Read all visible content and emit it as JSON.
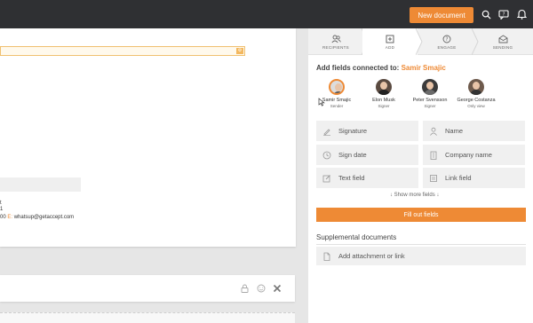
{
  "topbar": {
    "new_document_label": "New document"
  },
  "document": {
    "contact_line_1": "t",
    "contact_line_2": "1",
    "contact_prefix": "00",
    "contact_email_label": "E:",
    "contact_email": "whatsup@getaccept.com"
  },
  "steps": [
    {
      "label": "RECIPIENTS",
      "icon": "recipients-icon"
    },
    {
      "label": "ADD",
      "icon": "add-icon"
    },
    {
      "label": "ENGAGE",
      "icon": "engage-icon"
    },
    {
      "label": "SENDING",
      "icon": "sending-icon"
    }
  ],
  "panel": {
    "heading_prefix": "Add fields connected to:",
    "heading_name": "Samir Smajic",
    "recipients": [
      {
        "name": "Samir Smajic",
        "role": "Sender"
      },
      {
        "name": "Elon Musk",
        "role": "Signer"
      },
      {
        "name": "Peter Svensson",
        "role": "Signer"
      },
      {
        "name": "George Costanza",
        "role": "Only view"
      }
    ],
    "fields": [
      {
        "label": "Signature",
        "icon": "signature-icon"
      },
      {
        "label": "Name",
        "icon": "person-icon"
      },
      {
        "label": "Sign date",
        "icon": "clock-icon"
      },
      {
        "label": "Company name",
        "icon": "building-icon"
      },
      {
        "label": "Text field",
        "icon": "text-edit-icon"
      },
      {
        "label": "Link field",
        "icon": "link-icon"
      }
    ],
    "show_more": "Show more fields",
    "fill_out_label": "Fill out fields",
    "supplemental_title": "Supplemental documents",
    "attachment_label": "Add attachment or link"
  },
  "colors": {
    "accent": "#ee8a35",
    "topbar": "#2f3033"
  }
}
